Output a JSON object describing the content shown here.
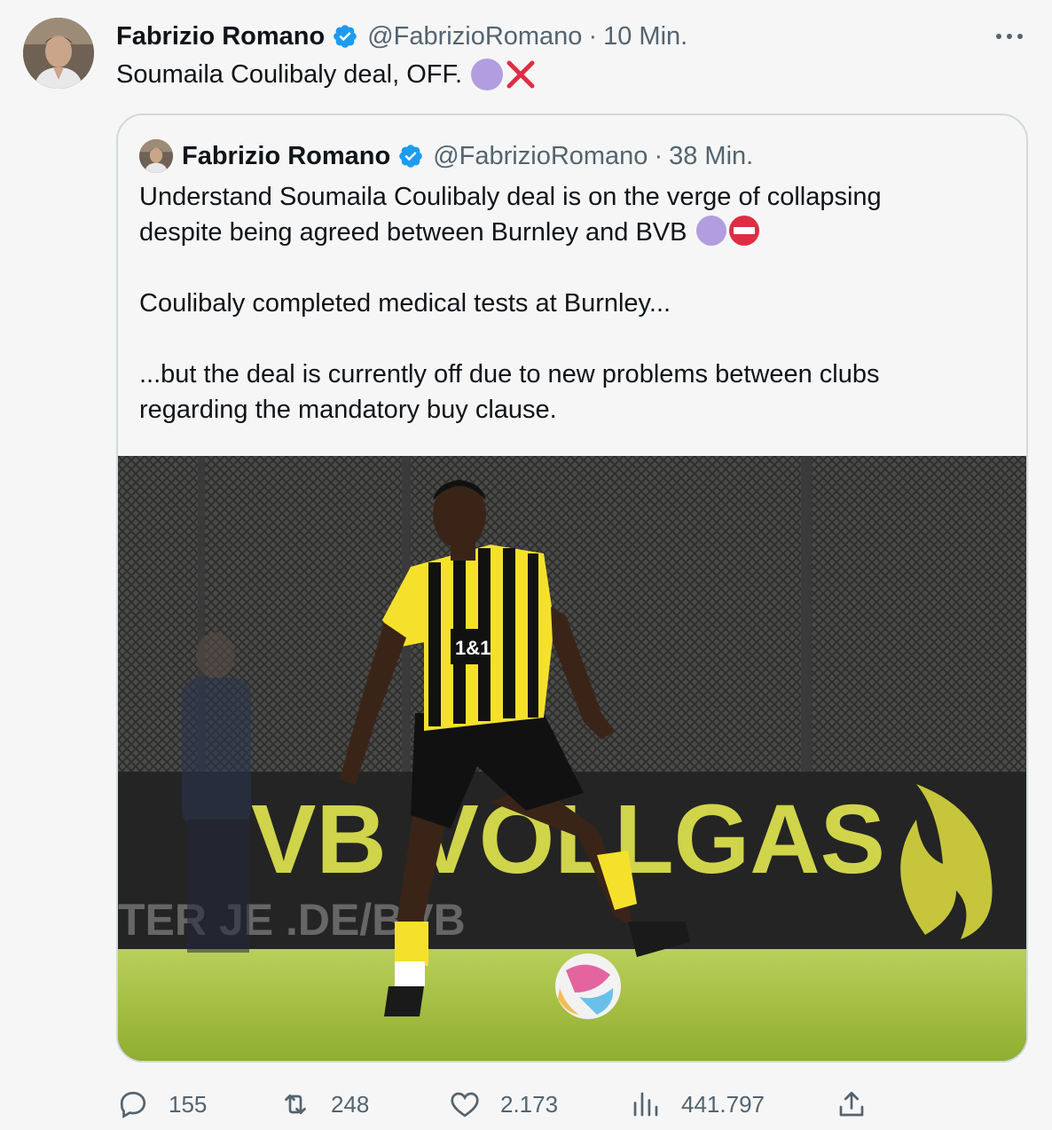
{
  "tweet": {
    "author_name": "Fabrizio Romano",
    "handle": "@FabrizioRomano",
    "separator": "·",
    "time": "10 Min.",
    "text": "Soumaila Coulibaly deal, OFF."
  },
  "quoted_tweet": {
    "author_name": "Fabrizio Romano",
    "handle": "@FabrizioRomano",
    "separator": "·",
    "time": "38 Min.",
    "line1": "Understand Soumaila Coulibaly deal is on the verge of collapsing",
    "line2": "despite being agreed between Burnley and BVB",
    "paragraph2": "Coulibaly completed medical tests at Burnley...",
    "paragraph3_line1": "...but the deal is currently off due to new problems between clubs",
    "paragraph3_line2": "regarding the mandatory buy clause.",
    "photo": {
      "ad_board_text": "VB VOLLGAS",
      "sponsor_text": "1&1",
      "lower_board_text": "TER JE .DE/BVB"
    }
  },
  "actions": {
    "replies": "155",
    "retweets": "248",
    "likes": "2.173",
    "views": "441.797"
  },
  "colors": {
    "verified": "#1d9bf0",
    "muted_text": "#536471",
    "purple_circle": "#b19ddf",
    "red_x": "#dd2e44",
    "border": "#cfd9de"
  },
  "icons": [
    "verified-badge-icon",
    "more-icon",
    "purple-circle-emoji",
    "cross-mark-emoji",
    "no-entry-emoji",
    "reply-icon",
    "retweet-icon",
    "like-icon",
    "views-icon",
    "share-icon"
  ]
}
